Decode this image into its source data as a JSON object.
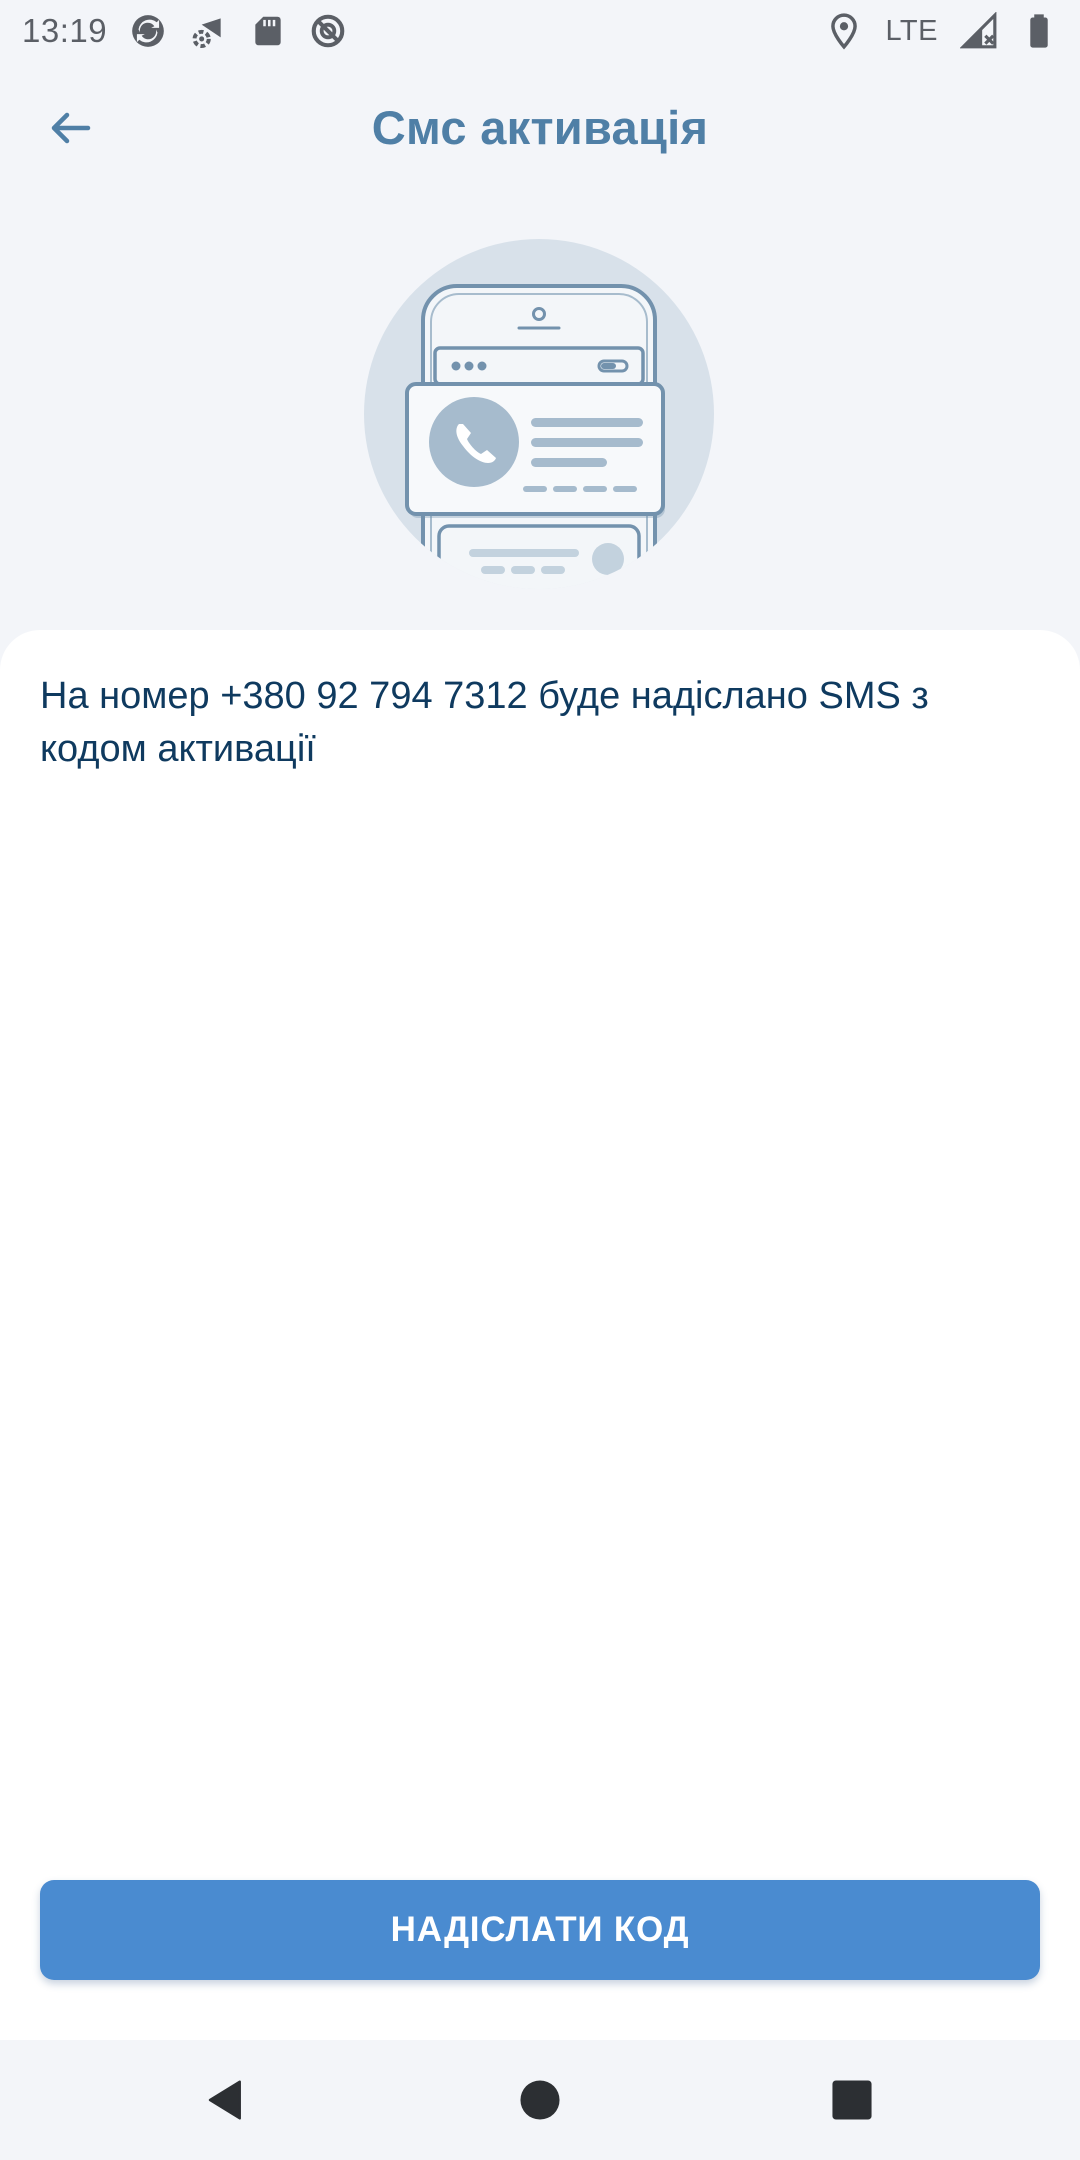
{
  "status_bar": {
    "time": "13:19",
    "network": "LTE",
    "icons": [
      "sync-icon",
      "settings-wifi-icon",
      "sd-card-icon",
      "no-sync-icon",
      "location-icon",
      "signal-icon",
      "battery-icon"
    ]
  },
  "header": {
    "back_icon": "arrow-left-icon",
    "title": "Смс активація"
  },
  "illustration": {
    "icon": "phone-contact-card-illustration"
  },
  "content": {
    "message": "На номер +380 92 794 7312 буде надіслано SMS з кодом активації"
  },
  "actions": {
    "send_code_label": "НАДІСЛАТИ КОД"
  },
  "nav_bar": {
    "icons": [
      "nav-back-icon",
      "nav-home-icon",
      "nav-recents-icon"
    ]
  },
  "colors": {
    "accent": "#4a8bd0",
    "title": "#4f7fa6",
    "text": "#0f3a5f",
    "background": "#f3f5f9"
  }
}
